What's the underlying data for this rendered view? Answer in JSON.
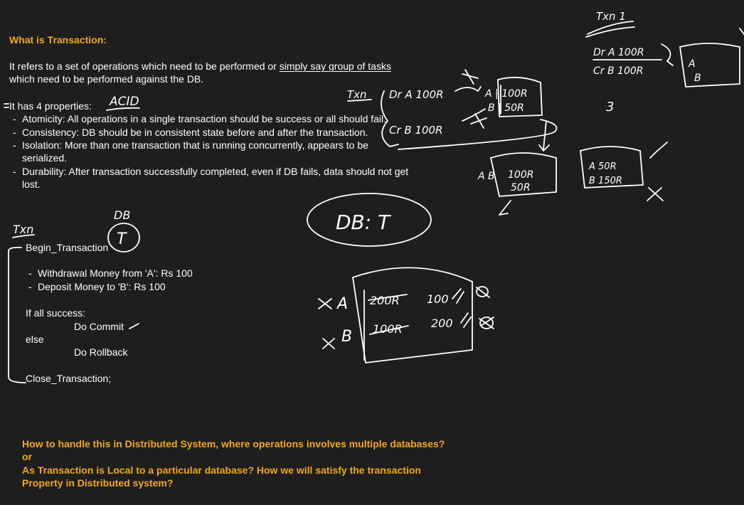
{
  "notes": {
    "heading": "What is Transaction:",
    "definition_part1": "It refers to a set of operations which need to be performed or ",
    "definition_underlined": "simply say group of tasks",
    "definition_line2": "which need to be performed against the DB.",
    "properties_intro": "It has 4 properties:",
    "properties": [
      "Atomicity: All operations in a single transaction should be success or all should fail.",
      "Consistency: DB should be in consistent state before and after the transaction.",
      "Isolation: More than one transaction that is running concurrently, appears to be",
      "serialized.",
      "Durability: After transaction successfully completed, even if DB fails, data should not get",
      "lost."
    ]
  },
  "code": {
    "begin": "Begin_Transaction",
    "steps": [
      "Withdrawal Money from 'A': Rs 100",
      "Deposit Money to 'B': Rs 100"
    ],
    "if_line": "If all success:",
    "commit": "Do Commit",
    "else_line": "else",
    "rollback": "Do Rollback",
    "close": "Close_Transaction;"
  },
  "questions": {
    "q1": "How to handle this in Distributed System, where operations involves multiple databases?",
    "or": "or",
    "q2_line1": "As Transaction is Local to a particular database? How we will satisfy the transaction",
    "q2_line2": "Property in Distributed system?"
  },
  "handwriting": {
    "acid": "ACID",
    "txn_left": "Txn",
    "db_small": "DB",
    "t_circle": "T",
    "db_t": "DB: T",
    "txn_mid": "Txn",
    "op1": "Dr A 100R",
    "op2": "Cr B 100R",
    "box1_a": "A | 100R",
    "box1_b": "B | 50R",
    "box2_labels": "A B",
    "box2_l1": "100R",
    "box2_l2": "50R",
    "box3_l1": "A 50R",
    "box3_l2": "B 150R",
    "txn1": "Txn 1",
    "txn1_op1": "Dr A 100R",
    "txn1_op2": "Cr B 100R",
    "txn1_close": "3",
    "box4_a": "A",
    "box4_b": "B",
    "big_a": "A",
    "big_b": "B",
    "big_a_old": "200R",
    "big_a_new": "100",
    "big_b_old": "100R",
    "big_b_new": "200"
  }
}
